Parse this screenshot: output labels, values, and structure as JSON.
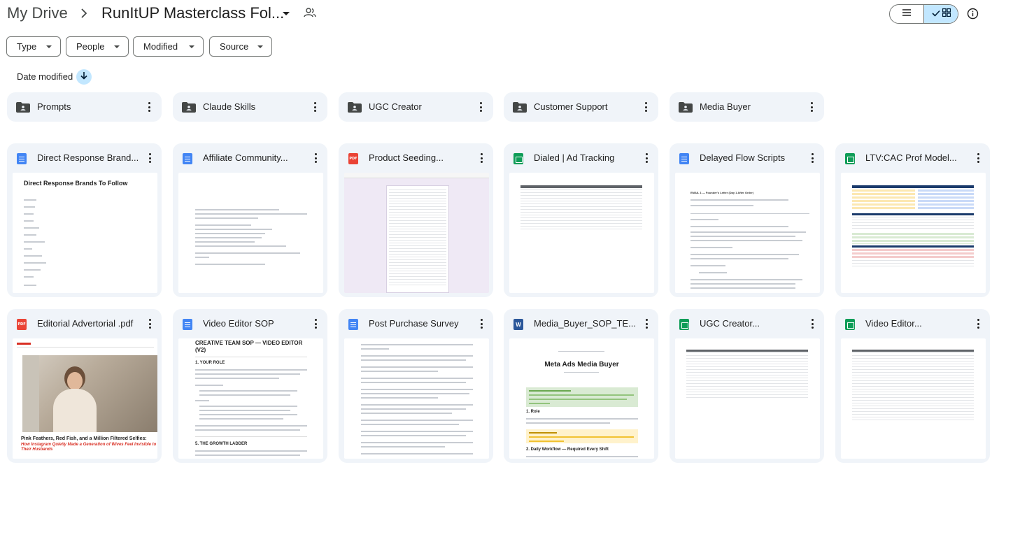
{
  "header": {
    "root": "My Drive",
    "current_folder": "RunItUP Masterclass Fol..."
  },
  "filters": {
    "type": "Type",
    "people": "People",
    "modified": "Modified",
    "source": "Source"
  },
  "sort": {
    "label": "Date modified"
  },
  "folders": [
    {
      "name": "Prompts"
    },
    {
      "name": "Claude Skills"
    },
    {
      "name": "UGC Creator"
    },
    {
      "name": "Customer Support"
    },
    {
      "name": "Media Buyer"
    }
  ],
  "files": [
    {
      "name": "Direct Response Brand...",
      "type": "doc"
    },
    {
      "name": "Affiliate Community...",
      "type": "doc"
    },
    {
      "name": "Product Seeding...",
      "type": "pdf"
    },
    {
      "name": "Dialed | Ad Tracking",
      "type": "sheet"
    },
    {
      "name": "Delayed Flow Scripts",
      "type": "doc"
    },
    {
      "name": "LTV:CAC Prof Model...",
      "type": "sheet"
    },
    {
      "name": "Editorial Advertorial .pdf",
      "type": "pdf"
    },
    {
      "name": "Video Editor SOP",
      "type": "doc"
    },
    {
      "name": "Post Purchase Survey",
      "type": "doc"
    },
    {
      "name": "Media_Buyer_SOP_TE...",
      "type": "word"
    },
    {
      "name": "UGC Creator...",
      "type": "sheet"
    },
    {
      "name": "Video Editor...",
      "type": "sheet"
    }
  ],
  "thumbnails": {
    "direct_response_title": "Direct Response Brands To Follow",
    "editorial_headline": "Pink Feathers, Red Fish, and a Million Filtered Selfies:",
    "editorial_subhead": "How Instagram Quietly Made a Generation of Wives Feel Invisible to Their Husbands",
    "video_sop_title": "CREATIVE TEAM SOP — VIDEO EDITOR (V2)",
    "video_sop_section1": "1. YOUR ROLE",
    "video_sop_section2": "5. THE GROWTH LADDER",
    "media_buyer_title": "Meta Ads Media Buyer",
    "media_buyer_section1": "1. Role",
    "media_buyer_section2": "2. Daily Workflow — Required Every Shift",
    "flow_title": "EMAIL 1 — Founder's Letter (Day 1 After Order)"
  },
  "icons": {
    "chevron": "chevron-right-icon",
    "dropdown": "arrow-drop-down-icon",
    "shared": "people-icon",
    "list": "list-view-icon",
    "grid": "grid-view-icon",
    "info": "info-icon",
    "sort": "arrow-down-icon",
    "folder": "shared-folder-icon",
    "more": "more-vert-icon"
  },
  "colors": {
    "accent": "#c2e7ff",
    "card_bg": "#f0f4f9",
    "doc": "#4285f4",
    "sheet": "#0f9d58",
    "pdf": "#ea4335",
    "word": "#2b579a"
  }
}
